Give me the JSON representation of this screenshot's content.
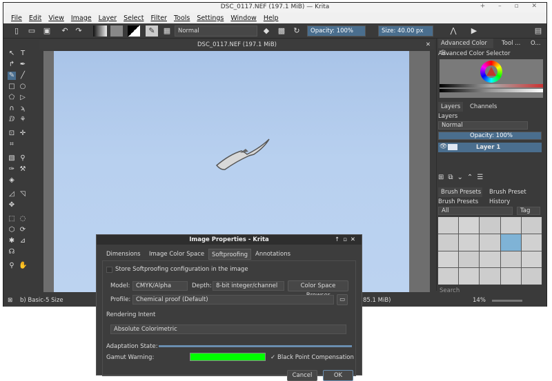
{
  "window": {
    "title": "DSC_0117.NEF (197.1 MiB)  — Krita",
    "controls": "+ – ▫ ✕"
  },
  "menu": [
    "File",
    "Edit",
    "View",
    "Image",
    "Layer",
    "Select",
    "Filter",
    "Tools",
    "Settings",
    "Window",
    "Help"
  ],
  "toolbar": {
    "blend_mode": "Normal",
    "opacity_label": "Opacity:",
    "opacity_value": "100%",
    "size_label": "Size:",
    "size_value": "40.00 px"
  },
  "document": {
    "tab_title": "DSC_0117.NEF (197.1 MiB)"
  },
  "right_panel": {
    "tabs": [
      "Advanced Color S...",
      "Tool ...",
      "O..."
    ],
    "color_selector_title": "Advanced Color Selector",
    "layers_tabs": [
      "Layers",
      "Channels"
    ],
    "layers_title": "Layers",
    "layer_blend": "Normal",
    "layer_opacity": "Opacity:  100%",
    "layer_name": "Layer 1",
    "presets_tabs": [
      "Brush Presets",
      "Brush Preset History"
    ],
    "presets_title": "Brush Presets",
    "preset_filter": "All",
    "tag_label": "Tag",
    "search_placeholder": "Search"
  },
  "status": {
    "brush": "b) Basic-5 Size",
    "size_info": "85.1 MiB)",
    "zoom": "14%"
  },
  "dialog": {
    "title": "Image Properties - Krita",
    "tabs": [
      "Dimensions",
      "Image Color Space",
      "Softproofing",
      "Annotations"
    ],
    "active_tab": "Softproofing",
    "store_label": "Store Softproofing configuration in the image",
    "model_label": "Model:",
    "model_value": "CMYK/Alpha",
    "depth_label": "Depth:",
    "depth_value": "8-bit integer/channel",
    "browser_button": "Color Space Browser",
    "profile_label": "Profile:",
    "profile_value": "Chemical proof (Default)",
    "intent_label": "Rendering Intent",
    "intent_value": "Absolute Colorimetric",
    "adaptation_label": "Adaptation State:",
    "gamut_label": "Gamut Warning:",
    "gamut_color": "#00ff00",
    "bpc_label": "Black Point Compensation",
    "cancel": "Cancel",
    "ok": "OK"
  }
}
